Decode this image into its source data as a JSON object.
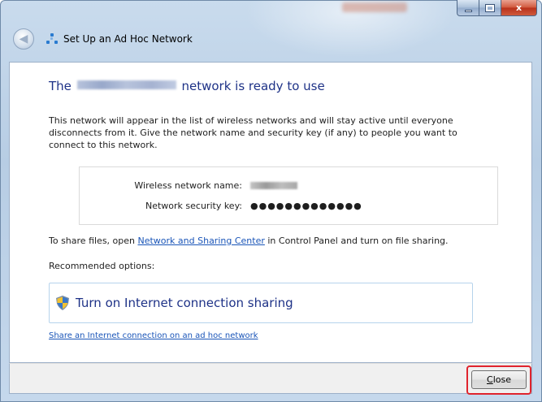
{
  "window": {
    "title": "Set Up an Ad Hoc Network",
    "close_glyph": "x"
  },
  "content": {
    "heading_prefix": "The",
    "heading_suffix": "network is ready to use",
    "description": "This network will appear in the list of wireless networks and will stay active until everyone disconnects from it. Give the network name and security key (if any) to people you want to connect to this network.",
    "details": {
      "name_label": "Wireless network name:",
      "key_label": "Network security key:",
      "key_value": "●●●●●●●●●●●●●"
    },
    "share_prefix": "To share files, open",
    "share_link": "Network and Sharing Center",
    "share_suffix": "in Control Panel and turn on file sharing.",
    "recommended_label": "Recommended options:",
    "option_label": "Turn on Internet connection sharing",
    "adhoc_link": "Share an Internet connection on an ad hoc network"
  },
  "footer": {
    "close_label_first": "C",
    "close_label_rest": "lose"
  },
  "icons": {
    "back": "back-arrow-icon",
    "app": "ad-hoc-network-icon",
    "option": "shield-icon"
  },
  "colors": {
    "heading": "#1e3287",
    "link": "#1a55b8",
    "highlight": "#e0242d"
  }
}
